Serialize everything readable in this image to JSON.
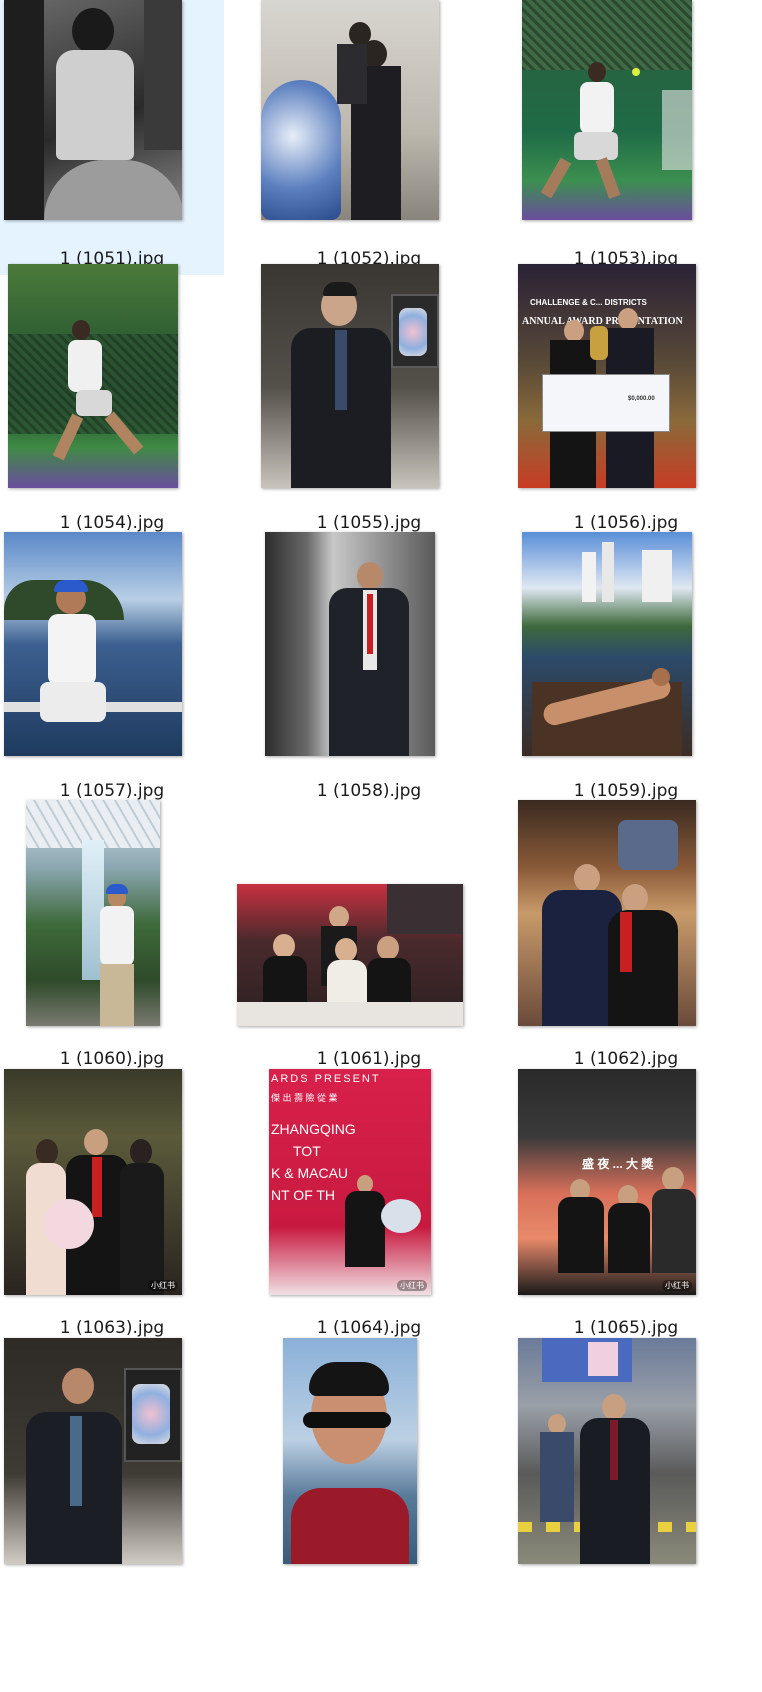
{
  "files": [
    {
      "name": "1 (1051).jpg",
      "selected": true
    },
    {
      "name": "1 (1052).jpg",
      "selected": false
    },
    {
      "name": "1 (1053).jpg",
      "selected": false
    },
    {
      "name": "1 (1054).jpg",
      "selected": false
    },
    {
      "name": "1 (1055).jpg",
      "selected": false
    },
    {
      "name": "1 (1056).jpg",
      "selected": false
    },
    {
      "name": "1 (1057).jpg",
      "selected": false
    },
    {
      "name": "1 (1058).jpg",
      "selected": false
    },
    {
      "name": "1 (1059).jpg",
      "selected": false
    },
    {
      "name": "1 (1060).jpg",
      "selected": false
    },
    {
      "name": "1 (1061).jpg",
      "selected": false
    },
    {
      "name": "1 (1062).jpg",
      "selected": false
    },
    {
      "name": "1 (1063).jpg",
      "selected": false
    },
    {
      "name": "1 (1064).jpg",
      "selected": false
    },
    {
      "name": "1 (1065).jpg",
      "selected": false
    },
    {
      "name": "",
      "selected": false
    },
    {
      "name": "",
      "selected": false
    },
    {
      "name": "",
      "selected": false
    }
  ],
  "photo_text": {
    "award_banner_line1": "CHALLENGE & C... DISTRICTS",
    "award_banner_line2": "ANNUAL AWARD PRESENTATION",
    "cheque_amount": "$0,000.00",
    "stage_line1": "ARDS PRESENT",
    "stage_line2": "傑 出 壽 險 從 業",
    "stage_line3": "ZHANGQING",
    "stage_line4": "TOT",
    "stage_line5": "K & MACAU",
    "stage_line6": "NT OF TH",
    "screen_text": "盛 夜 ... 大 獎",
    "watermark": "小红书"
  }
}
